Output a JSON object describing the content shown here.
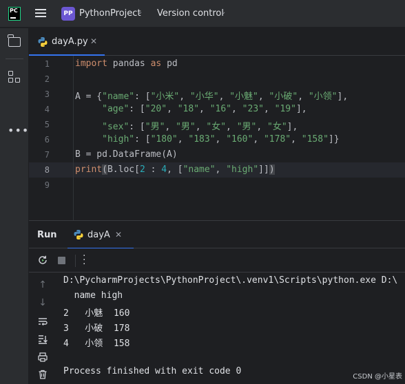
{
  "titlebar": {
    "logo_text": "PC",
    "project_badge": "PP",
    "project_name": "PythonProject",
    "vcs_label": "Version control"
  },
  "editor": {
    "tab_label": "dayA.py",
    "line_numbers": [
      "1",
      "2",
      "3",
      "4",
      "5",
      "6",
      "7",
      "8",
      "9"
    ],
    "current_line": "8",
    "code": {
      "l1": {
        "kw1": "import",
        "t1": " pandas ",
        "kw2": "as",
        "t2": " pd"
      },
      "l3": {
        "t1": "A = {",
        "s1": "\"name\"",
        "t2": ": [",
        "s2": "\"小米\"",
        "c1": ", ",
        "s3": "\"小华\"",
        "c2": ", ",
        "s4": "\"小魅\"",
        "c3": ", ",
        "s5": "\"小破\"",
        "c4": ", ",
        "s6": "\"小领\"",
        "t3": "],"
      },
      "l4": {
        "t1": "     ",
        "s1": "\"age\"",
        "t2": ": [",
        "s2": "\"20\"",
        "c1": ", ",
        "s3": "\"18\"",
        "c2": ", ",
        "s4": "\"16\"",
        "c3": ", ",
        "s5": "\"23\"",
        "c4": ", ",
        "s6": "\"19\"",
        "t3": "],"
      },
      "l5": {
        "t1": "     ",
        "s1": "\"sex\"",
        "t2": ": [",
        "s2": "\"男\"",
        "c1": ", ",
        "s3": "\"男\"",
        "c2": ", ",
        "s4": "\"女\"",
        "c3": ", ",
        "s5": "\"男\"",
        "c4": ", ",
        "s6": "\"女\"",
        "t3": "],"
      },
      "l6": {
        "t1": "     ",
        "s1": "\"high\"",
        "t2": ": [",
        "s2": "\"180\"",
        "c1": ", ",
        "s3": "\"183\"",
        "c2": ", ",
        "s4": "\"160\"",
        "c3": ", ",
        "s5": "\"178\"",
        "c4": ", ",
        "s6": "\"158\"",
        "t3": "]}"
      },
      "l7": {
        "t1": "B = pd.DataFrame(A)"
      },
      "l8": {
        "kw1": "print",
        "b1": "(",
        "t1": "B.loc[",
        "n1": "2",
        "t2": " : ",
        "n2": "4",
        "t3": ", [",
        "s1": "\"name\"",
        "c1": ", ",
        "s2": "\"high\"",
        "t4": "]]",
        "b2": ")"
      }
    }
  },
  "run": {
    "title": "Run",
    "tab_label": "dayA",
    "console_lines": [
      "D:\\PycharmProjects\\PythonProject\\.venv1\\Scripts\\python.exe D:\\",
      "  name high",
      "2   小魅  160",
      "3   小破  178",
      "4   小领  158",
      "",
      "Process finished with exit code 0"
    ]
  },
  "watermark": "CSDN @小星表",
  "colors": {
    "background": "#1e1f22",
    "panel": "#2b2d30",
    "accent": "#3574f0",
    "keyword": "#cf8e6d",
    "string": "#6aab73",
    "number": "#2aacb8",
    "text": "#bcbec4",
    "project_badge": "#6b57d2",
    "logo_border": "#21d789"
  }
}
